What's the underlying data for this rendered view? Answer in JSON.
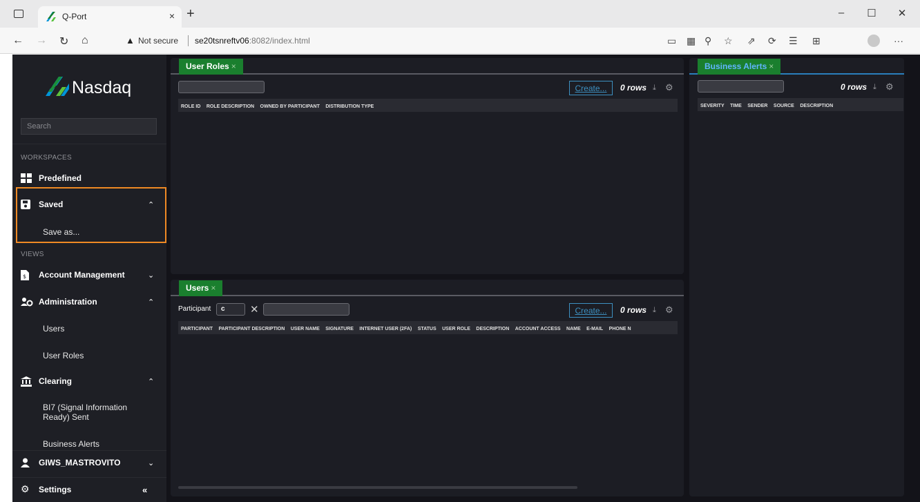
{
  "browser": {
    "tab_title": "Q-Port",
    "tab_close": "×",
    "new_tab": "+",
    "window_controls": [
      "–",
      "☐",
      "✕"
    ],
    "security_label": "Not secure",
    "url_host": "se20tsnreftv06",
    "url_rest": ":8082/index.html"
  },
  "app": {
    "logo_text": "Nasdaq",
    "search_placeholder": "Search",
    "workspaces_label": "WORKSPACES",
    "views_label": "VIEWS",
    "nav": {
      "predefined": "Predefined",
      "saved": "Saved",
      "save_as": "Save as...",
      "account_management": "Account Management",
      "administration": "Administration",
      "users": "Users",
      "user_roles": "User Roles",
      "clearing": "Clearing",
      "bi7": "BI7 (Signal Information Ready) Sent",
      "business_alerts": "Business Alerts",
      "user": "GIWS_MASTROVITO",
      "settings": "Settings"
    },
    "colors": {
      "accent_green": "#1a7f2e",
      "highlight": "#f08a24",
      "link_blue": "#3d91c2"
    }
  },
  "panels": {
    "user_roles": {
      "tab": "User Roles",
      "create": "Create...",
      "rows": "0 rows",
      "columns": [
        "ROLE ID",
        "ROLE DESCRIPTION",
        "OWNED BY PARTICIPANT",
        "DISTRIBUTION TYPE"
      ]
    },
    "users": {
      "tab": "Users",
      "participant_label": "Participant",
      "participant_value": "c",
      "create": "Create...",
      "rows": "0 rows",
      "columns": [
        "PARTICIPANT",
        "PARTICIPANT DESCRIPTION",
        "USER NAME",
        "SIGNATURE",
        "INTERNET USER (2FA)",
        "STATUS",
        "USER ROLE",
        "DESCRIPTION",
        "ACCOUNT ACCESS",
        "NAME",
        "E-MAIL",
        "PHONE N"
      ]
    },
    "business_alerts": {
      "tab": "Business Alerts",
      "rows": "0 rows",
      "columns": [
        "SEVERITY",
        "TIME",
        "SENDER",
        "SOURCE",
        "DESCRIPTION"
      ]
    }
  }
}
